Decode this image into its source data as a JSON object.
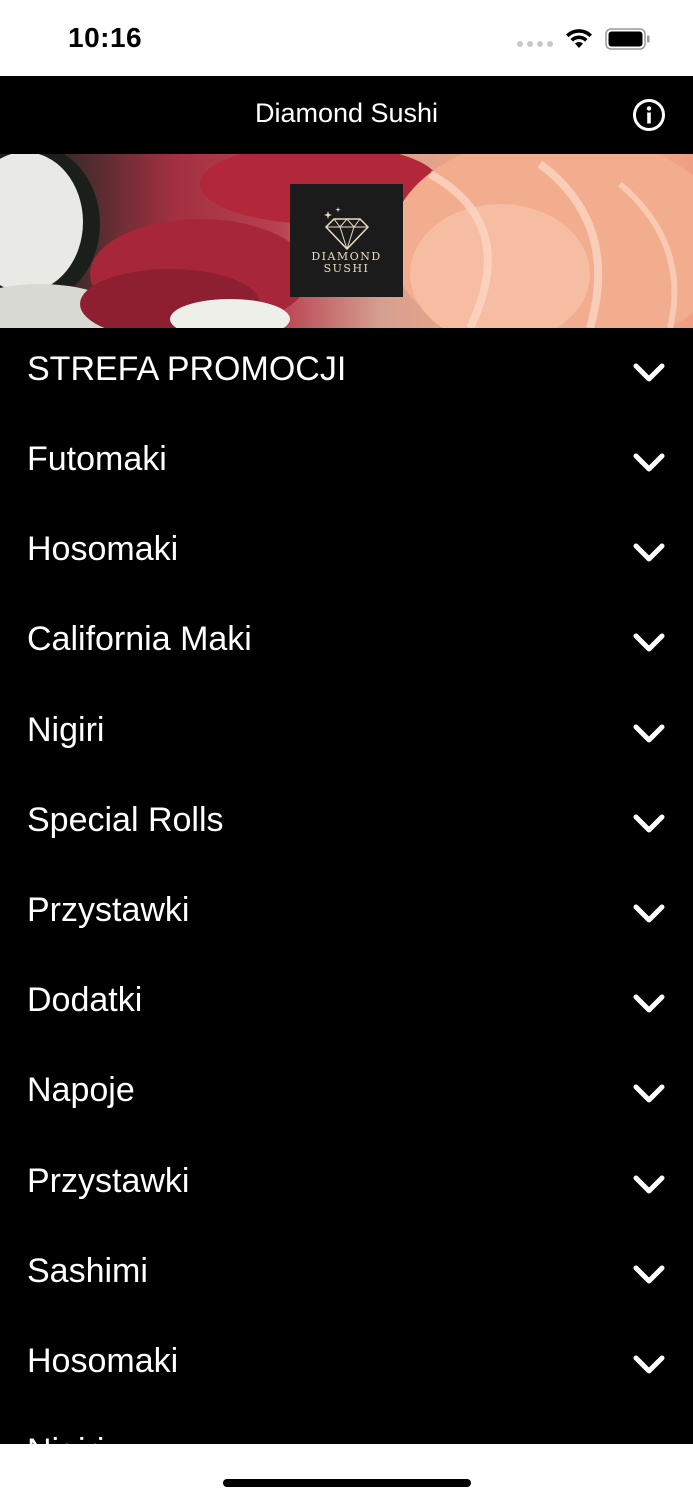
{
  "status_bar": {
    "time": "10:16",
    "icons": [
      "cellular-signal-icon",
      "wifi-icon",
      "battery-icon"
    ]
  },
  "nav": {
    "title": "Diamond Sushi",
    "info_icon": "info-icon"
  },
  "banner": {
    "logo_line1": "DIAMOND",
    "logo_line2": "SUSHI",
    "logo_icon": "diamond-icon"
  },
  "menu": {
    "items": [
      {
        "label": "STREFA PROMOCJI"
      },
      {
        "label": "Futomaki"
      },
      {
        "label": "Hosomaki"
      },
      {
        "label": "California Maki"
      },
      {
        "label": "Nigiri"
      },
      {
        "label": "Special Rolls"
      },
      {
        "label": "Przystawki"
      },
      {
        "label": "Dodatki"
      },
      {
        "label": "Napoje"
      },
      {
        "label": "Przystawki"
      },
      {
        "label": "Sashimi"
      },
      {
        "label": "Hosomaki"
      },
      {
        "label": "Nigiri"
      }
    ],
    "chevron_icon": "chevron-down-icon"
  },
  "colors": {
    "nav_background": "#000000",
    "menu_background": "#000000",
    "text": "#ffffff",
    "logo_gold": "#e8dcc0"
  }
}
